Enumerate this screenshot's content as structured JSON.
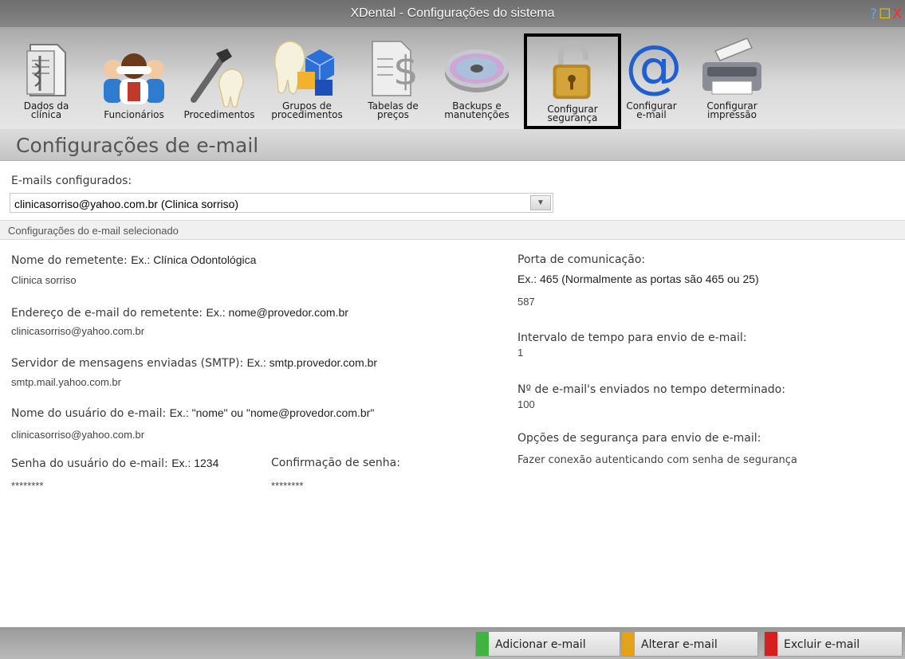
{
  "window": {
    "title": "XDental - Configurações do sistema",
    "help_glyph": "?",
    "maximize_glyph": "☐",
    "close_glyph": "X"
  },
  "toolbar": {
    "items": [
      {
        "label": "Dados da\nclínica",
        "icon": "document-icon"
      },
      {
        "label": "Funcionários",
        "icon": "people-icon"
      },
      {
        "label": "Procedimentos",
        "icon": "dental-tool-icon"
      },
      {
        "label": "Grupos de\nprocedimentos",
        "icon": "tooth-cubes-icon"
      },
      {
        "label": "Tabelas de\npreços",
        "icon": "price-doc-icon"
      },
      {
        "label": "Backups e\nmanutenções",
        "icon": "disc-icon"
      },
      {
        "label": "Configurar\nsegurança",
        "icon": "padlock-icon",
        "active": true
      },
      {
        "label": "Configurar\ne-mail",
        "icon": "at-sign-icon"
      },
      {
        "label": "Configurar\nimpressão",
        "icon": "printer-icon"
      }
    ]
  },
  "section": {
    "title": "Configurações de e-mail"
  },
  "emails": {
    "label": "E-mails configurados:",
    "selected": "clinicasorriso@yahoo.com.br (Clinica sorriso)",
    "dropdown_glyph": "▼"
  },
  "subheader": "Configurações do e-mail selecionado",
  "left": {
    "sender_name": {
      "label": "Nome do remetente:",
      "example": "Ex.: Clínica Odontológica",
      "value": "Clinica sorriso"
    },
    "sender_email": {
      "label": "Endereço de e-mail do remetente:",
      "example": "Ex.: nome@provedor.com.br",
      "value": "clinicasorriso@yahoo.com.br"
    },
    "smtp": {
      "label": "Servidor de mensagens enviadas (SMTP):",
      "example": "Ex.: smtp.provedor.com.br",
      "value": "smtp.mail.yahoo.com.br"
    },
    "username": {
      "label": "Nome do usuário do e-mail:",
      "example": "Ex.: \"nome\" ou \"nome@provedor.com.br\"",
      "value": "clinicasorriso@yahoo.com.br"
    },
    "password": {
      "label": "Senha do usuário do e-mail:",
      "example": "Ex.: 1234",
      "value": "********"
    },
    "confirm": {
      "label": "Confirmação de senha:",
      "value": "********"
    }
  },
  "right": {
    "port": {
      "label": "Porta de comunicação:",
      "example": "Ex.: 465 (Normalmente as portas são 465 ou 25)",
      "value": "587"
    },
    "interval": {
      "label": "Intervalo de tempo para envio de e-mail:",
      "value": "1"
    },
    "count": {
      "label": "Nº de e-mail's enviados no tempo determinado:",
      "value": "100"
    },
    "security": {
      "label": "Opções de segurança para envio de e-mail:",
      "value": "Fazer conexão autenticando com senha de segurança"
    }
  },
  "buttons": {
    "add": "Adicionar e-mail",
    "edit": "Alterar e-mail",
    "delete": "Excluir e-mail"
  },
  "colors": {
    "add_accent": "#3fb43f",
    "edit_accent": "#e3a21a",
    "delete_accent": "#d81f1f"
  }
}
